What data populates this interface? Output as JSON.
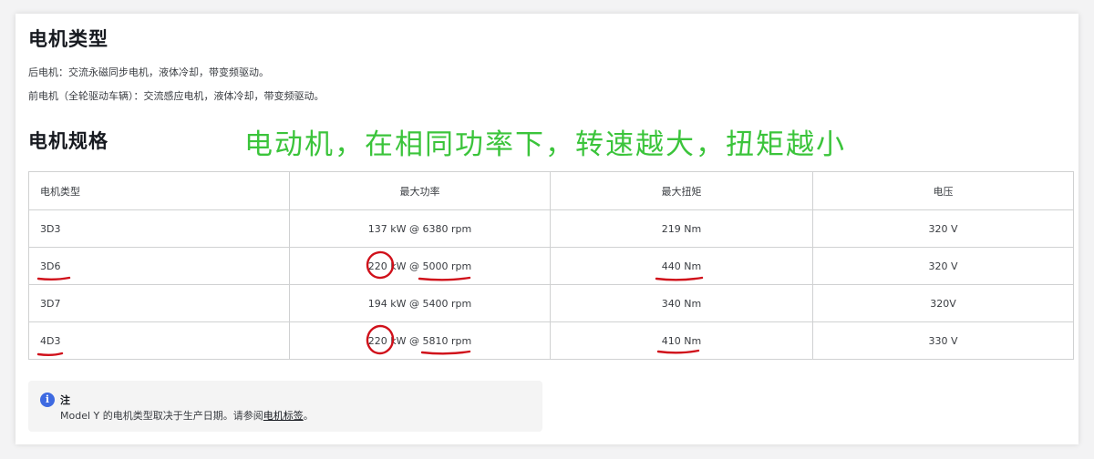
{
  "section1": {
    "title": "电机类型",
    "rear": "后电机：交流永磁同步电机，液体冷却，带变频驱动。",
    "front": "前电机（全轮驱动车辆）：交流感应电机，液体冷却，带变频驱动。"
  },
  "section2": {
    "title": "电机规格"
  },
  "annotation": "电动机，在相同功率下，转速越大，扭矩越小",
  "table": {
    "headers": [
      "电机类型",
      "最大功率",
      "最大扭矩",
      "电压"
    ],
    "rows": [
      [
        "3D3",
        "137 kW @ 6380 rpm",
        "219 Nm",
        "320 V"
      ],
      [
        "3D6",
        "220 kW @ 5000 rpm",
        "440 Nm",
        "320 V"
      ],
      [
        "3D7",
        "194 kW @ 5400 rpm",
        "340 Nm",
        "320V"
      ],
      [
        "4D3",
        "220 kW @ 5810 rpm",
        "410 Nm",
        "330 V"
      ]
    ]
  },
  "note": {
    "icon": "info-icon",
    "icon_glyph": "i",
    "title": "注",
    "text_before": "Model Y 的电机类型取决于生产日期。请参阅",
    "link": "电机标签",
    "text_after": "。"
  },
  "colors": {
    "annotation_green": "#3bc43b",
    "markup_red": "#d0101a",
    "info_blue": "#3e6ae1"
  }
}
